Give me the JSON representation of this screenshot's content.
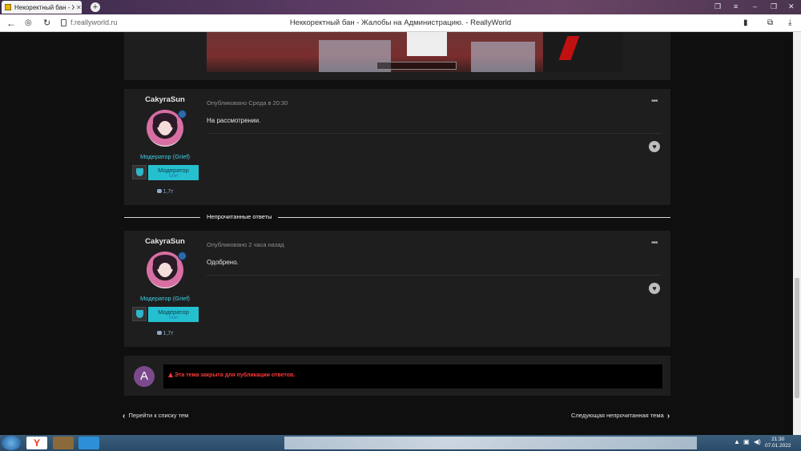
{
  "browser": {
    "tab_title": "Некоректный бан - Ж",
    "new_tab": "+",
    "url": "f.reallyworld.ru",
    "page_title": "Неккоректный бан - Жалобы на Администрацию. - ReallyWorld"
  },
  "posts": [
    {
      "author": "CakyraSun",
      "meta": "Опубликовано Среда в 20:30",
      "content": "На рассмотрении.",
      "role": "Модератор (Grief)",
      "group": "Модератор",
      "group_sub": "Grief",
      "reputation": "1,7т"
    },
    {
      "author": "CakyraSun",
      "meta": "Опубликовано 2 часа назад",
      "content": "Одобрено.",
      "role": "Модератор (Grief)",
      "group": "Модератор",
      "group_sub": "Grief",
      "reputation": "1,7т"
    }
  ],
  "unread_label": "Непрочитанные ответы",
  "closed": {
    "avatar_letter": "A",
    "message": "Эта тема закрыта для публикации ответов."
  },
  "nav": {
    "back": "Перейти к списку тем",
    "next": "Следующая непрочитанная тема"
  },
  "taskbar": {
    "time": "21:30",
    "date": "07.01.2022"
  }
}
